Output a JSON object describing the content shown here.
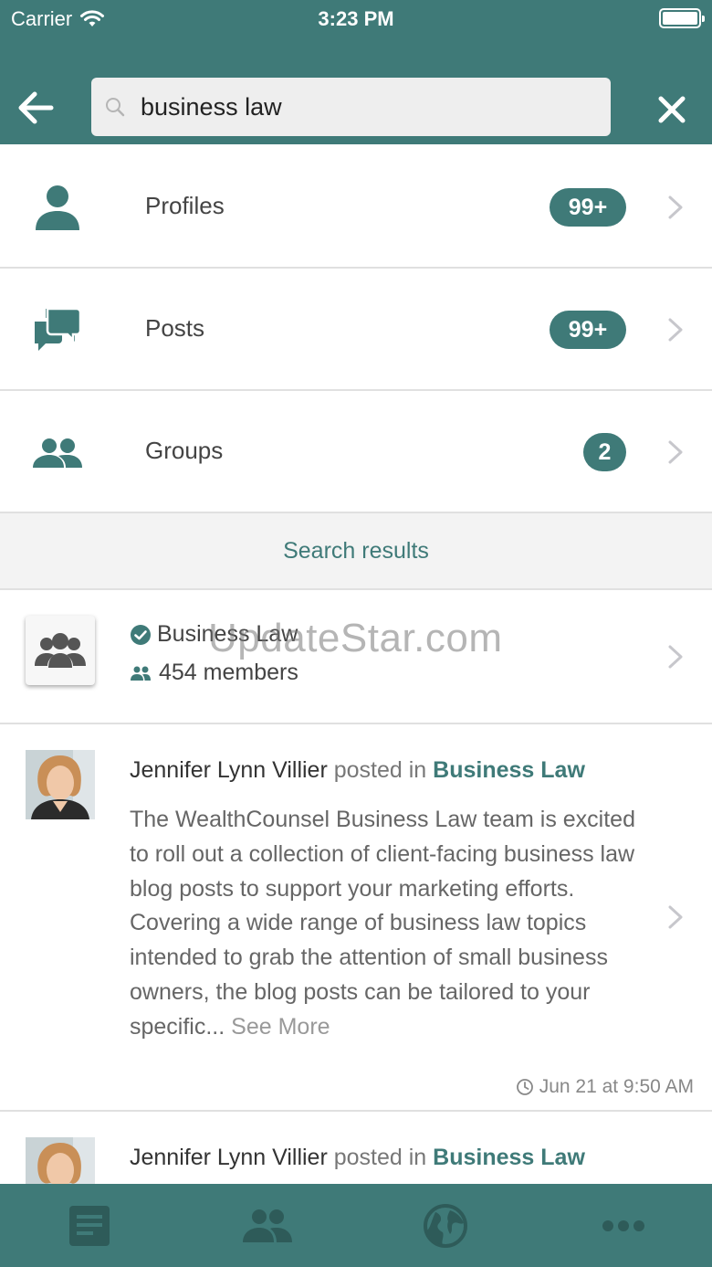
{
  "status_bar": {
    "carrier": "Carrier",
    "time": "3:23 PM"
  },
  "header": {
    "search_value": "business law"
  },
  "categories": [
    {
      "label": "Profiles",
      "count": "99+",
      "icon": "person-icon"
    },
    {
      "label": "Posts",
      "count": "99+",
      "icon": "chat-bubbles-icon"
    },
    {
      "label": "Groups",
      "count": "2",
      "icon": "group-icon"
    }
  ],
  "section_title": "Search results",
  "group_result": {
    "name": "Business Law",
    "members": "454 members"
  },
  "watermark": "UpdateStar.com",
  "posts": [
    {
      "author": "Jennifer Lynn Villier",
      "connector": "posted in",
      "group": "Business Law",
      "body": "The WealthCounsel Business Law team is excited to roll out a collection of client-facing business law blog posts to support your marketing efforts. Covering a wide range of business law topics intended to grab the attention of small business owners, the blog posts can be tailored to your specific...",
      "see_more": "See More",
      "time": "Jun 21 at 9:50 AM"
    },
    {
      "author": "Jennifer Lynn Villier",
      "connector": "posted in",
      "group": "Business Law"
    }
  ],
  "colors": {
    "brand": "#3f7a78",
    "divider": "#e0e0e0",
    "tab_icon": "#2e5b59"
  },
  "tabs": [
    {
      "icon": "feed-icon"
    },
    {
      "icon": "people-icon"
    },
    {
      "icon": "globe-icon"
    },
    {
      "icon": "more-icon"
    }
  ]
}
